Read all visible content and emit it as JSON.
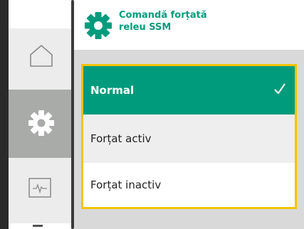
{
  "header": {
    "title_line1": "Comandă forțată",
    "title_line2": "releu SSM",
    "icon": "gear-icon"
  },
  "sidebar": {
    "items": [
      {
        "name": "home",
        "icon": "home-icon"
      },
      {
        "name": "settings",
        "icon": "gear-icon",
        "selected": true
      },
      {
        "name": "diagnostics",
        "icon": "pulse-monitor-icon"
      }
    ]
  },
  "list": {
    "items": [
      {
        "label": "Normal",
        "selected": true
      },
      {
        "label": "Forțat activ",
        "selected": false
      },
      {
        "label": "Forțat inactiv",
        "selected": false
      }
    ]
  },
  "colors": {
    "accent": "#009b7d",
    "focus_border": "#f5c400",
    "panel": "#d9d9d9"
  }
}
